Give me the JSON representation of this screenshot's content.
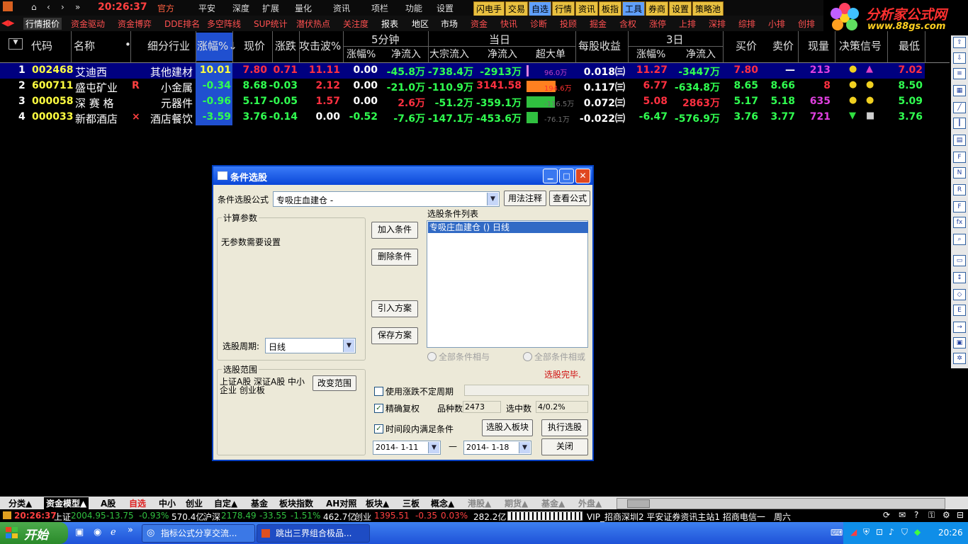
{
  "topbar": {
    "clock": "20:26:37",
    "items": [
      "官方",
      "平安",
      "深度",
      "扩展",
      "量化",
      "资讯",
      "项栏",
      "功能",
      "设置"
    ],
    "yellow": [
      "闪电手",
      "交易",
      "自选",
      "行情",
      "资讯",
      "板指",
      "工具",
      "券商",
      "设置",
      "策略池"
    ]
  },
  "logo": {
    "title": "分析家公式网",
    "url": "www.88gs.com"
  },
  "tabs": [
    "行情报价",
    "资金驱动",
    "资金博弈",
    "DDE排名",
    "多空阵线",
    "SUP统计",
    "潜伏热点",
    "关注度",
    "报表",
    "地区",
    "市场",
    "资金",
    "快讯",
    "诊断",
    "投顾",
    "掘金",
    "含权",
    "涨停",
    "上排",
    "深排",
    "综排",
    "小排",
    "创排"
  ],
  "header": {
    "code": "代码",
    "name": "名称",
    "dot": "•",
    "industry": "细分行业",
    "pct": "涨幅%↓",
    "price": "现价",
    "change": "涨跌",
    "attack": "攻击波%",
    "min5": "5分钟",
    "min5_pct": "涨幅%",
    "min5_flow": "净流入",
    "today": "当日",
    "block_flow": "大宗流入",
    "net_flow": "净流入",
    "super": "超大单",
    "eps": "每股收益",
    "d3": "3日",
    "d3_pct": "涨幅%",
    "d3_flow": "净流入",
    "bid": "买价",
    "ask": "卖价",
    "vol": "现量",
    "signal": "决策信号",
    "low": "最低"
  },
  "rows": [
    {
      "no": "1",
      "code": "002468",
      "name": "艾迪西",
      "flag": "",
      "industry": "其他建材",
      "pct": "10.01",
      "price": "7.80",
      "change": "0.71",
      "attack": "11.11",
      "m5pct": "0.00",
      "m5flow": "-45.8万",
      "block": "-738.4万",
      "net": "-2913万",
      "super": "96.0万",
      "super_level": 0.05,
      "eps": "0.018㈢",
      "d3pct": "11.27",
      "d3flow": "-3447万",
      "bid": "7.80",
      "ask": "—",
      "vol": "213",
      "low": "7.02"
    },
    {
      "no": "2",
      "code": "600711",
      "name": "盛屯矿业",
      "flag": "R",
      "industry": "小金属",
      "pct": "-0.34",
      "price": "8.68",
      "change": "-0.03",
      "attack": "2.12",
      "m5pct": "0.00",
      "m5flow": "-21.0万",
      "block": "-110.9万",
      "net": "3141.58",
      "super": "194.6万",
      "super_level": 0.9,
      "eps": "0.117㈢",
      "d3pct": "6.77",
      "d3flow": "-634.8万",
      "bid": "8.65",
      "ask": "8.66",
      "vol": "8",
      "low": "8.50"
    },
    {
      "no": "3",
      "code": "000058",
      "name": "深 赛 格",
      "flag": "",
      "industry": "元器件",
      "pct": "-0.96",
      "price": "5.17",
      "change": "-0.05",
      "attack": "1.57",
      "m5pct": "0.00",
      "m5flow": "2.6万",
      "block": "-51.2万",
      "net": "-359.1万",
      "super": "-116.5万",
      "super_level": 0.88,
      "eps": "0.072㈢",
      "d3pct": "5.08",
      "d3flow": "2863万",
      "bid": "5.17",
      "ask": "5.18",
      "vol": "635",
      "low": "5.09"
    },
    {
      "no": "4",
      "code": "000033",
      "name": "新都酒店",
      "flag": "×",
      "industry": "酒店餐饮",
      "pct": "-3.59",
      "price": "3.76",
      "change": "-0.14",
      "attack": "0.00",
      "m5pct": "-0.52",
      "m5flow": "-7.6万",
      "block": "-147.1万",
      "net": "-453.6万",
      "super": "-76.1万",
      "super_level": 0.35,
      "eps": "-0.022㈢",
      "d3pct": "-6.47",
      "d3flow": "-576.9万",
      "bid": "3.76",
      "ask": "3.77",
      "vol": "721",
      "low": "3.76"
    }
  ],
  "dialog": {
    "title": "条件选股",
    "formula_label": "条件选股公式",
    "formula_value": "专吸庄血建仓 -",
    "btn_usage": "用法注释",
    "btn_view": "查看公式",
    "params_group": "计算参数",
    "params_text": "无参数需要设置",
    "period_label": "选股周期:",
    "period_value": "日线",
    "btn_add": "加入条件",
    "btn_delete": "删除条件",
    "btn_import": "引入方案",
    "btn_save": "保存方案",
    "list_label": "选股条件列表",
    "list_items": [
      "专吸庄血建仓 () 日线"
    ],
    "radio_and": "全部条件相与",
    "radio_or": "全部条件相或",
    "done": "选股完毕.",
    "scope_group": "选股范围",
    "scope_text": "上证A股 深证A股 中小企业 创业板",
    "btn_scope": "改变范围",
    "chk_vary": "使用涨跌不定周期",
    "chk_exact": "精确复权",
    "count_label": "品种数",
    "count_value": "2473",
    "selected_label": "选中数",
    "selected_value": "4/0.2%",
    "chk_time": "时间段内满足条件",
    "btn_to_block": "选股入板块",
    "btn_exec": "执行选股",
    "date_from": "2014- 1-11",
    "dash": "—",
    "date_to": "2014- 1-18",
    "btn_close": "关闭"
  },
  "bottom_tabs": [
    "分类▲",
    "资金模型▲",
    "A股",
    "自选",
    "中小",
    "创业",
    "自定▲",
    "基金",
    "板块指数",
    "AH对照",
    "板块▲",
    "三板",
    "概念▲",
    "港股▲",
    "期货▲",
    "基金▲",
    "外盘▲"
  ],
  "status": {
    "time": "20:26:37",
    "sh_label": "上证",
    "sh_value": "2004.95",
    "sh_change": "-13.75",
    "sh_pct": "-0.93%",
    "sh_amount": "570.4亿",
    "hs_label": "沪深",
    "hs_value": "2178.49",
    "hs_change": "-33.55",
    "hs_pct": "-1.51%",
    "hs_amount": "462.7亿",
    "cy_label": "创业",
    "cy_value": "1395.51",
    "cy_change": "-0.35",
    "cy_pct": "0.03%",
    "cy_amount": "282.2亿",
    "vip": "VIP_招商深圳2  平安证券资讯主站1  招商电信一",
    "day": "周六"
  },
  "taskbar": {
    "start": "开始",
    "task1": "指标公式分享交流...",
    "task2": "跳出三界组合极品...",
    "time": "20:26"
  },
  "colors": {
    "accent": "#0a46d8",
    "up": "#ff3040",
    "down": "#30ff50"
  }
}
